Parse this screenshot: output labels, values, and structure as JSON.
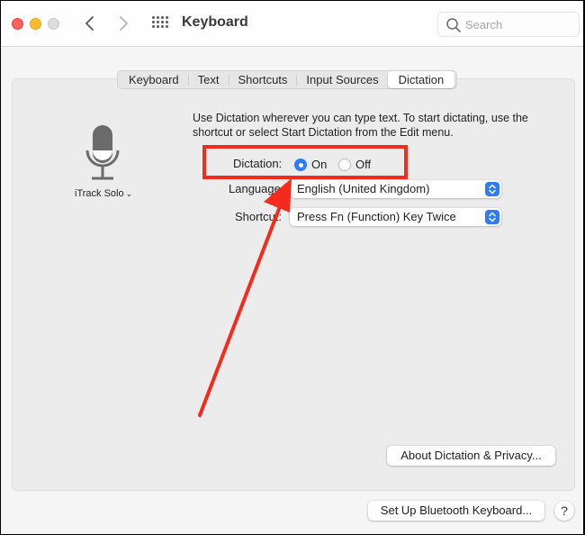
{
  "window": {
    "title": "Keyboard",
    "search_placeholder": "Search"
  },
  "tabs": [
    {
      "label": "Keyboard",
      "active": false
    },
    {
      "label": "Text",
      "active": false
    },
    {
      "label": "Shortcuts",
      "active": false
    },
    {
      "label": "Input Sources",
      "active": false
    },
    {
      "label": "Dictation",
      "active": true
    }
  ],
  "microphone": {
    "icon": "microphone-icon",
    "source_label": "iTrack Solo",
    "chevron": "⌄"
  },
  "description": "Use Dictation wherever you can type text. To start dictating, use the shortcut or select Start Dictation from the Edit menu.",
  "dictation": {
    "label": "Dictation:",
    "options": [
      {
        "label": "On",
        "selected": true
      },
      {
        "label": "Off",
        "selected": false
      }
    ]
  },
  "language": {
    "label": "Language:",
    "value": "English (United Kingdom)"
  },
  "shortcut": {
    "label": "Shortcut:",
    "value": "Press Fn (Function) Key Twice"
  },
  "buttons": {
    "about": "About Dictation & Privacy...",
    "bluetooth": "Set Up Bluetooth Keyboard...",
    "help": "?"
  },
  "annotation": {
    "color": "#f42a1d",
    "note": "Red highlight box around Dictation On/Off with arrow pointing to it"
  },
  "colors": {
    "accent": "#2f7cf6",
    "traffic_close": "#fe5f57",
    "traffic_min": "#febc2e",
    "traffic_max": "#dcdcdc"
  }
}
